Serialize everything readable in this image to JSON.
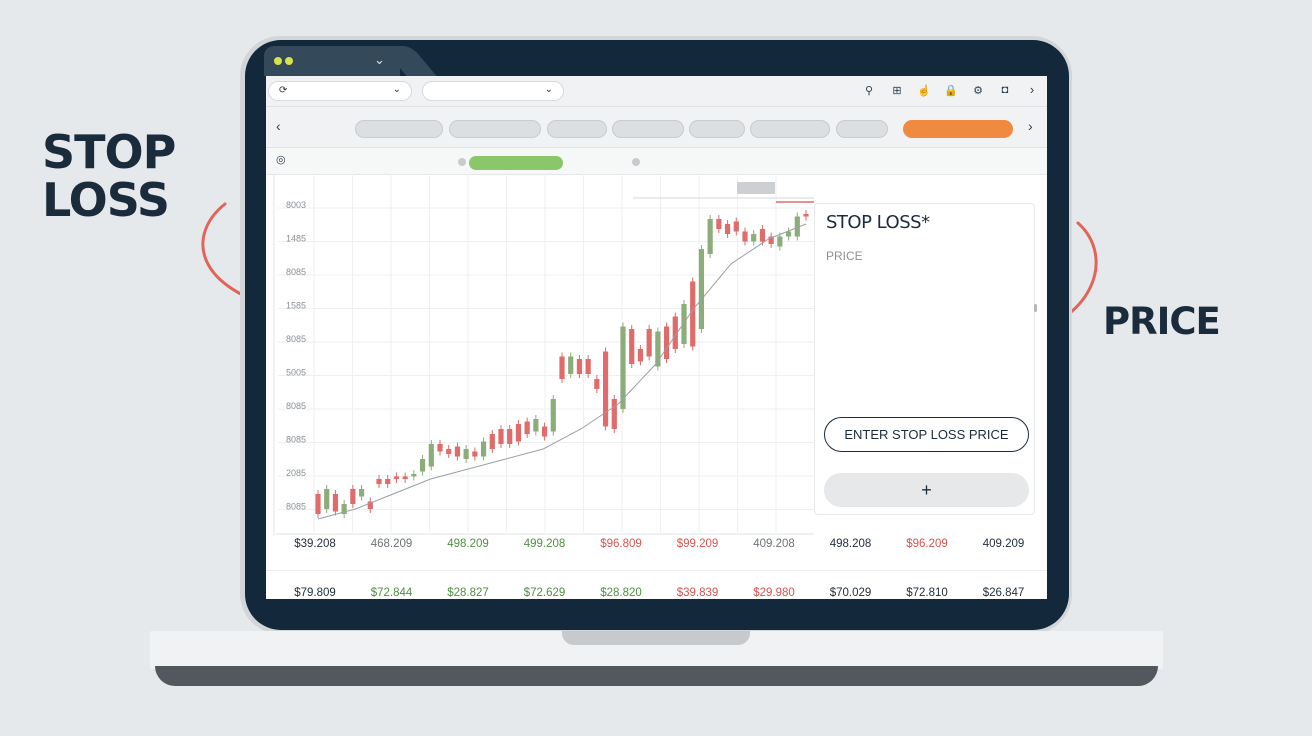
{
  "callouts": {
    "stop_loss": "STOP LOSS",
    "price": "PRICE"
  },
  "colors": {
    "background": "#e6e9eb",
    "bezel": "#13283a",
    "bull": "#8aad7a",
    "bear": "#e06b6b",
    "accent_orange": "#f08a40",
    "accent_green": "#8cc66a",
    "arrow": "#e0645a"
  },
  "browser": {
    "tab_dots": 2,
    "addr_field_1_icon": "⟳",
    "chevron": "⌄",
    "nav_prev": "‹",
    "nav_next": "›",
    "toolbar_icons": [
      "pin-icon",
      "grid-icon",
      "hand-icon",
      "lock-icon",
      "gear-icon",
      "camera-icon"
    ],
    "toolbar_glyphs": [
      "⚲",
      "⊞",
      "☝",
      "🔒",
      "⚙",
      "◘"
    ]
  },
  "stop_loss_panel": {
    "title": "STOP LOSS*",
    "field_label": "PRICE",
    "enter_button": "ENTER STOP LOSS PRICE",
    "add_button": "+"
  },
  "chart_data": {
    "type": "candlestick",
    "y_tick_labels": [
      "8003",
      "1485",
      "8085",
      "1585",
      "8085",
      "5005",
      "8085",
      "8085",
      "2085",
      "8085"
    ],
    "candles": [
      {
        "o": 0.12,
        "c": 0.2,
        "dir": "down"
      },
      {
        "o": 0.14,
        "c": 0.22,
        "dir": "up"
      },
      {
        "o": 0.13,
        "c": 0.2,
        "dir": "down"
      },
      {
        "o": 0.12,
        "c": 0.16,
        "dir": "up"
      },
      {
        "o": 0.16,
        "c": 0.22,
        "dir": "down"
      },
      {
        "o": 0.19,
        "c": 0.22,
        "dir": "up"
      },
      {
        "o": 0.17,
        "c": 0.14,
        "dir": "down"
      },
      {
        "o": 0.24,
        "c": 0.26,
        "dir": "down"
      },
      {
        "o": 0.24,
        "c": 0.26,
        "dir": "down"
      },
      {
        "o": 0.26,
        "c": 0.27,
        "dir": "down"
      },
      {
        "o": 0.26,
        "c": 0.27,
        "dir": "down"
      },
      {
        "o": 0.27,
        "c": 0.28,
        "dir": "up"
      },
      {
        "o": 0.29,
        "c": 0.34,
        "dir": "up"
      },
      {
        "o": 0.31,
        "c": 0.4,
        "dir": "up"
      },
      {
        "o": 0.4,
        "c": 0.37,
        "dir": "down"
      },
      {
        "o": 0.38,
        "c": 0.36,
        "dir": "down"
      },
      {
        "o": 0.39,
        "c": 0.35,
        "dir": "down"
      },
      {
        "o": 0.34,
        "c": 0.38,
        "dir": "up"
      },
      {
        "o": 0.35,
        "c": 0.37,
        "dir": "down"
      },
      {
        "o": 0.35,
        "c": 0.41,
        "dir": "up"
      },
      {
        "o": 0.38,
        "c": 0.44,
        "dir": "down"
      },
      {
        "o": 0.4,
        "c": 0.46,
        "dir": "down"
      },
      {
        "o": 0.4,
        "c": 0.46,
        "dir": "down"
      },
      {
        "o": 0.41,
        "c": 0.48,
        "dir": "down"
      },
      {
        "o": 0.44,
        "c": 0.49,
        "dir": "down"
      },
      {
        "o": 0.45,
        "c": 0.5,
        "dir": "up"
      },
      {
        "o": 0.43,
        "c": 0.47,
        "dir": "down"
      },
      {
        "o": 0.45,
        "c": 0.58,
        "dir": "up"
      },
      {
        "o": 0.66,
        "c": 0.75,
        "dir": "down"
      },
      {
        "o": 0.68,
        "c": 0.75,
        "dir": "up"
      },
      {
        "o": 0.68,
        "c": 0.74,
        "dir": "down"
      },
      {
        "o": 0.68,
        "c": 0.74,
        "dir": "down"
      },
      {
        "o": 0.62,
        "c": 0.66,
        "dir": "down"
      },
      {
        "o": 0.47,
        "c": 0.77,
        "dir": "down"
      },
      {
        "o": 0.46,
        "c": 0.58,
        "dir": "down"
      },
      {
        "o": 0.54,
        "c": 0.87,
        "dir": "up"
      },
      {
        "o": 0.72,
        "c": 0.86,
        "dir": "down"
      },
      {
        "o": 0.78,
        "c": 0.73,
        "dir": "down"
      },
      {
        "o": 0.75,
        "c": 0.86,
        "dir": "down"
      },
      {
        "o": 0.71,
        "c": 0.85,
        "dir": "up"
      },
      {
        "o": 0.74,
        "c": 0.87,
        "dir": "down"
      },
      {
        "o": 0.78,
        "c": 0.91,
        "dir": "down"
      },
      {
        "o": 0.8,
        "c": 0.96,
        "dir": "up"
      },
      {
        "o": 0.79,
        "c": 1.05,
        "dir": "down"
      },
      {
        "o": 0.86,
        "c": 1.18,
        "dir": "up"
      },
      {
        "o": 1.16,
        "c": 1.3,
        "dir": "up"
      },
      {
        "o": 1.26,
        "c": 1.3,
        "dir": "down"
      },
      {
        "o": 1.24,
        "c": 1.28,
        "dir": "down"
      },
      {
        "o": 1.25,
        "c": 1.29,
        "dir": "down"
      },
      {
        "o": 1.21,
        "c": 1.25,
        "dir": "down"
      },
      {
        "o": 1.21,
        "c": 1.24,
        "dir": "up"
      },
      {
        "o": 1.21,
        "c": 1.26,
        "dir": "down"
      },
      {
        "o": 1.2,
        "c": 1.23,
        "dir": "down"
      },
      {
        "o": 1.19,
        "c": 1.23,
        "dir": "up"
      },
      {
        "o": 1.23,
        "c": 1.25,
        "dir": "up"
      },
      {
        "o": 1.23,
        "c": 1.31,
        "dir": "up"
      },
      {
        "o": 1.31,
        "c": 1.32,
        "dir": "down"
      }
    ],
    "ma_line": [
      0.1,
      0.14,
      0.2,
      0.26,
      0.3,
      0.34,
      0.38,
      0.46,
      0.56,
      0.72,
      0.94,
      1.12,
      1.22,
      1.28
    ]
  },
  "prices": {
    "row1": [
      {
        "text": "$39.208",
        "tone": "dark"
      },
      {
        "text": "468.209",
        "tone": "grey"
      },
      {
        "text": "498.209",
        "tone": "green"
      },
      {
        "text": "499.208",
        "tone": "green"
      },
      {
        "text": "$96.809",
        "tone": "red"
      },
      {
        "text": "$99.209",
        "tone": "red"
      },
      {
        "text": "409.208",
        "tone": "grey"
      },
      {
        "text": "498.208",
        "tone": "dark"
      },
      {
        "text": "$96.209",
        "tone": "red"
      },
      {
        "text": "409.209",
        "tone": "dark"
      }
    ],
    "row2": [
      {
        "text": "$79.809",
        "tone": "dark"
      },
      {
        "text": "$72.844",
        "tone": "green"
      },
      {
        "text": "$28.827",
        "tone": "green"
      },
      {
        "text": "$72.629",
        "tone": "green"
      },
      {
        "text": "$28.820",
        "tone": "green"
      },
      {
        "text": "$39.839",
        "tone": "red"
      },
      {
        "text": "$29.980",
        "tone": "red"
      },
      {
        "text": "$70.029",
        "tone": "dark"
      },
      {
        "text": "$72.810",
        "tone": "dark"
      },
      {
        "text": "$26.847",
        "tone": "dark"
      }
    ]
  }
}
